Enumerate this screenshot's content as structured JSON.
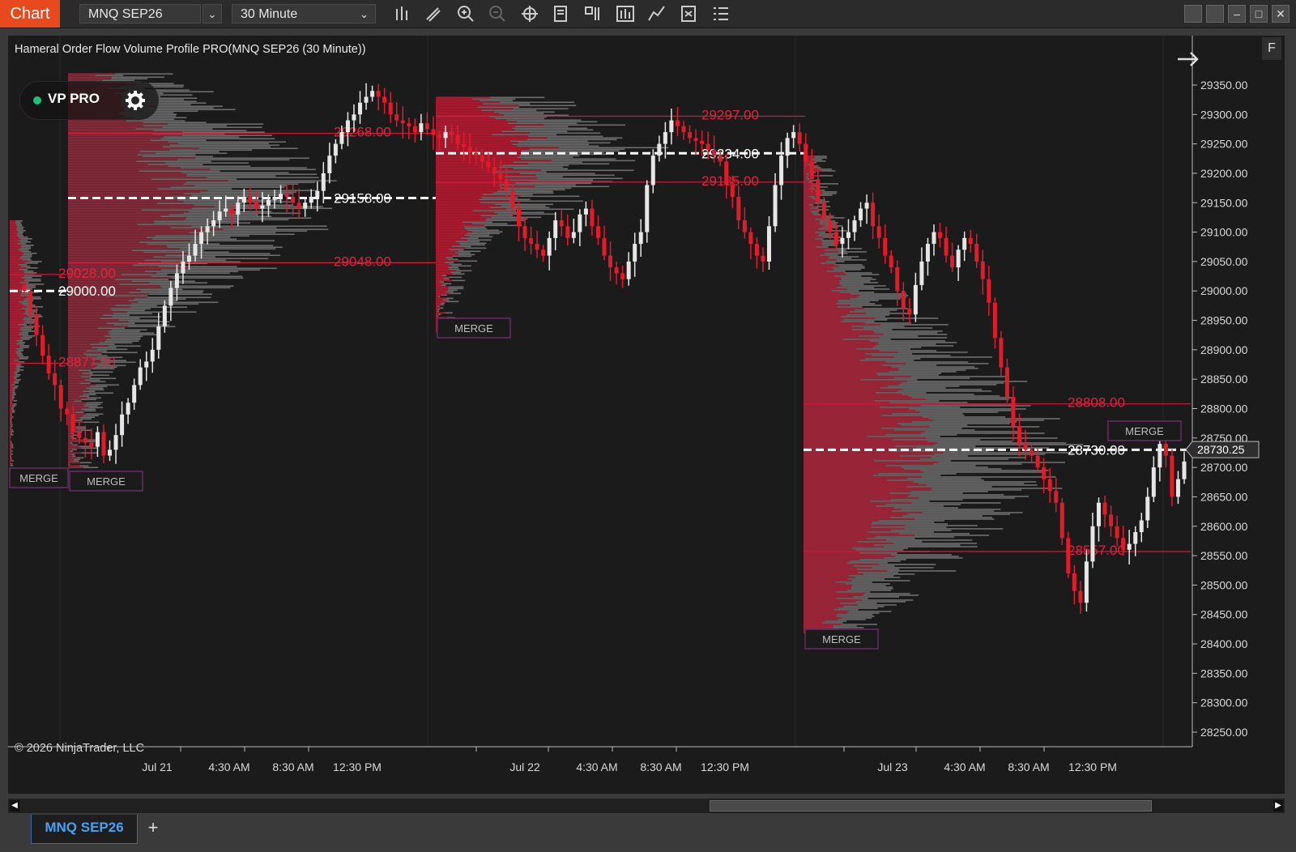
{
  "window": {
    "tab_label": "Chart",
    "instrument": "MNQ SEP26",
    "interval": "30 Minute",
    "dropdown_glyph": "⌄",
    "colors": {
      "accent": "#e8491d",
      "up_candle": "#e6e6e6",
      "down_candle": "#e21b2a",
      "poc_line": "#ffffff",
      "level_line": "#d2193a",
      "tab_text": "#4aa0f0"
    }
  },
  "toolbar_icons": [
    "bar-type-icon",
    "pencil-icon",
    "zoom-in-icon",
    "zoom-out-icon",
    "crosshair-icon",
    "properties-icon",
    "strategy-icon",
    "indicator-icon",
    "drawing-tools-icon",
    "data-box-icon",
    "list-icon"
  ],
  "chart": {
    "title": "Hameral Order Flow Volume Profile PRO(MNQ SEP26 (30 Minute))",
    "badge_label": "VP PRO",
    "copyright": "© 2026 NinjaTrader, LLC",
    "f_label": "F",
    "current_price": "28730.25",
    "merge_label": "MERGE"
  },
  "chart_data": {
    "type": "candlestick",
    "y_axis": {
      "range": [
        28220,
        29395
      ],
      "ticks": [
        "29350.00",
        "29300.00",
        "29250.00",
        "29200.00",
        "29150.00",
        "29100.00",
        "29050.00",
        "29000.00",
        "28950.00",
        "28900.00",
        "28850.00",
        "28800.00",
        "28750.00",
        "28700.00",
        "28650.00",
        "28600.00",
        "28550.00",
        "28500.00",
        "28450.00",
        "28400.00",
        "28350.00",
        "28300.00",
        "28250.00"
      ]
    },
    "x_axis": {
      "labels": [
        "Jul 21",
        "4:30 AM",
        "8:30 AM",
        "12:30 PM",
        "Jul 22",
        "4:30 AM",
        "8:30 AM",
        "12:30 PM",
        "Jul 23",
        "4:30 AM",
        "8:30 AM",
        "12:30 PM"
      ]
    },
    "sessions": [
      {
        "name": "s0",
        "poc": 29000,
        "levels": [
          29028,
          28877
        ],
        "labels": [
          {
            "text": "29028.00",
            "price": 29028,
            "color": "red"
          },
          {
            "text": "29000.00",
            "price": 29000,
            "color": "white"
          },
          {
            "text": "28877.00",
            "price": 28877,
            "color": "red"
          }
        ]
      },
      {
        "name": "s1",
        "poc": 29158,
        "levels": [
          29268,
          29048
        ],
        "labels": [
          {
            "text": "29268.00",
            "price": 29268,
            "color": "red"
          },
          {
            "text": "29158.00",
            "price": 29158,
            "color": "white"
          },
          {
            "text": "29048.00",
            "price": 29048,
            "color": "red"
          }
        ]
      },
      {
        "name": "s2",
        "poc": 29234,
        "levels": [
          29297,
          29185
        ],
        "labels": [
          {
            "text": "29297.00",
            "price": 29297,
            "color": "red"
          },
          {
            "text": "29234.00",
            "price": 29234,
            "color": "white"
          },
          {
            "text": "29185.00",
            "price": 29185,
            "color": "red"
          }
        ]
      },
      {
        "name": "s3",
        "poc": 28730,
        "levels": [
          28808,
          28557
        ],
        "labels": [
          {
            "text": "28808.00",
            "price": 28808,
            "color": "red"
          },
          {
            "text": "28730.00",
            "price": 28730,
            "color": "white"
          },
          {
            "text": "28557.00",
            "price": 28557,
            "color": "red"
          }
        ]
      }
    ],
    "candles_close": [
      29000,
      28960,
      28925,
      28890,
      28860,
      28840,
      28800,
      28790,
      28760,
      28750,
      28742,
      28735,
      28760,
      28720,
      28730,
      28755,
      28790,
      28810,
      28840,
      28870,
      28880,
      28900,
      28940,
      28975,
      29005,
      29030,
      29050,
      29060,
      29080,
      29100,
      29110,
      29120,
      29135,
      29140,
      29130,
      29150,
      29160,
      29150,
      29140,
      29145,
      29155,
      29160,
      29165,
      29160,
      29150,
      29140,
      29150,
      29160,
      29170,
      29200,
      29230,
      29250,
      29270,
      29290,
      29300,
      29320,
      29330,
      29340,
      29330,
      29320,
      29300,
      29290,
      29285,
      29280,
      29270,
      29285,
      29275,
      29265,
      29260,
      29270,
      29265,
      29250,
      29245,
      29235,
      29230,
      29220,
      29210,
      29200,
      29190,
      29170,
      29140,
      29110,
      29090,
      29080,
      29070,
      29060,
      29090,
      29120,
      29110,
      29090,
      29100,
      29130,
      29140,
      29110,
      29090,
      29060,
      29040,
      29030,
      29020,
      29050,
      29080,
      29100,
      29180,
      29230,
      29250,
      29270,
      29290,
      29280,
      29270,
      29260,
      29255,
      29250,
      29240,
      29230,
      29220,
      29180,
      29160,
      29120,
      29100,
      29080,
      29060,
      29050,
      29110,
      29180,
      29230,
      29260,
      29270,
      29250,
      29220,
      29190,
      29150,
      29120,
      29100,
      29080,
      29090,
      29100,
      29120,
      29140,
      29150,
      29110,
      29090,
      29060,
      29040,
      29000,
      28970,
      28960,
      29010,
      29050,
      29080,
      29100,
      29090,
      29060,
      29040,
      29070,
      29090,
      29080,
      29050,
      29020,
      28980,
      28920,
      28870,
      28820,
      28770,
      28740,
      28730,
      28720,
      28700,
      28680,
      28660,
      28640,
      28580,
      28520,
      28490,
      28470,
      28540,
      28600,
      28640,
      28620,
      28600,
      28580,
      28560,
      28570,
      28590,
      28610,
      28650,
      28700,
      28740,
      28720,
      28650,
      28680,
      28710
    ],
    "volume_profile": "drawn by script from session ranges (bid/ask colored bars)"
  }
}
